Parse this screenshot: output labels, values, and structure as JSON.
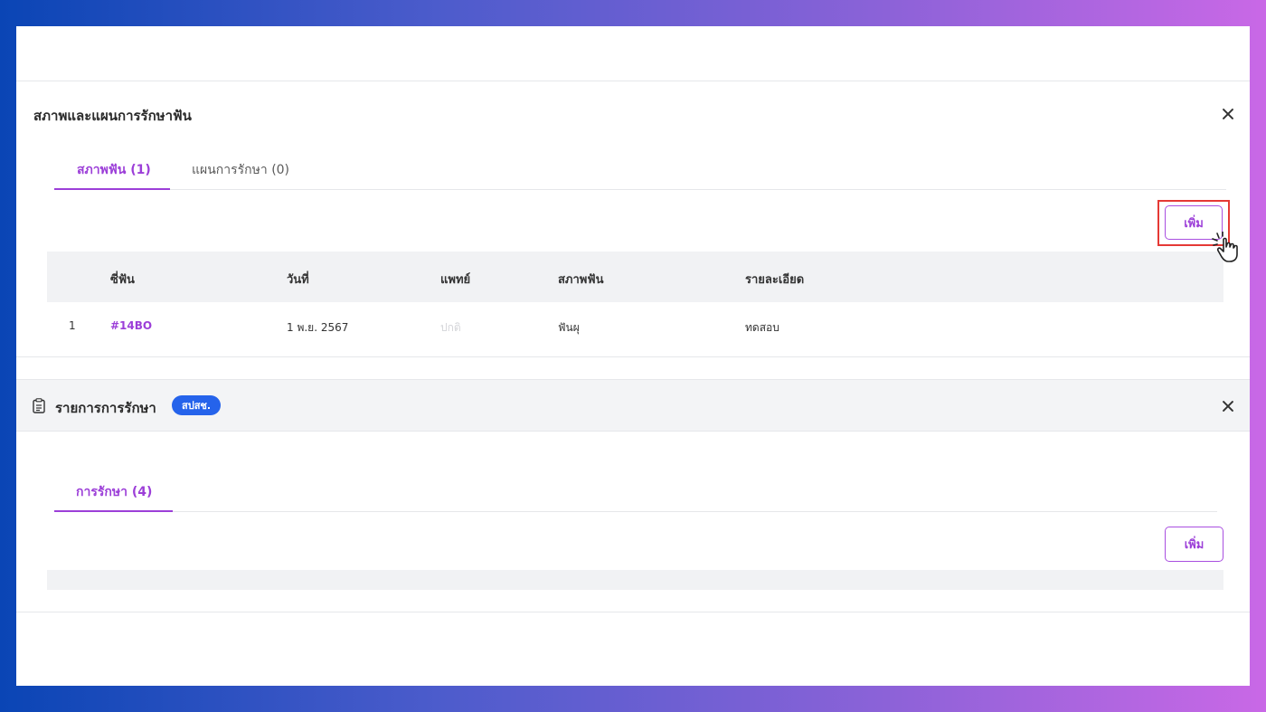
{
  "panel1": {
    "title": "สภาพและแผนการรักษาฟัน",
    "tabs": [
      {
        "label": "สภาพฟัน (1)"
      },
      {
        "label": "แผนการรักษา (0)"
      }
    ],
    "add_label": "เพิ่ม",
    "table": {
      "headers": [
        "ซี่ฟัน",
        "วันที่",
        "แพทย์",
        "สภาพฟัน",
        "รายละเอียด"
      ],
      "rows": [
        {
          "index": "1",
          "tooth": "#14BO",
          "date": "1 พ.ย. 2567",
          "doctor": "ปกติ",
          "condition": "ฟันผุ",
          "detail": "ทดสอบ"
        }
      ]
    }
  },
  "panel2": {
    "title": "รายการการรักษา",
    "badge": "สปสช.",
    "tabs": [
      {
        "label": "การรักษา (4)"
      }
    ],
    "add_label": "เพิ่ม"
  },
  "colors": {
    "accent": "#9c3fd8",
    "badge": "#2563eb",
    "highlight": "#e53935"
  }
}
